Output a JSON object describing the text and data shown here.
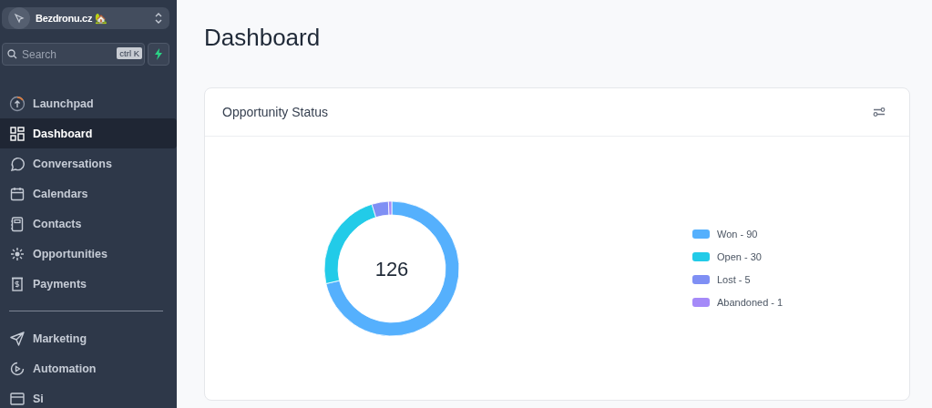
{
  "sidebar": {
    "account": {
      "name": "Bezdronu.cz",
      "emoji": "🏡"
    },
    "search": {
      "placeholder": "Search",
      "shortcut": "ctrl K"
    },
    "items": [
      {
        "label": "Launchpad",
        "selected": false
      },
      {
        "label": "Dashboard",
        "selected": true
      },
      {
        "label": "Conversations",
        "selected": false
      },
      {
        "label": "Calendars",
        "selected": false
      },
      {
        "label": "Contacts",
        "selected": false
      },
      {
        "label": "Opportunities",
        "selected": false
      },
      {
        "label": "Payments",
        "selected": false
      },
      {
        "label": "Marketing",
        "selected": false,
        "divider_before": true
      },
      {
        "label": "Automation",
        "selected": false
      },
      {
        "label": "Si",
        "selected": false
      }
    ]
  },
  "page": {
    "title": "Dashboard"
  },
  "card": {
    "title": "Opportunity Status",
    "total": "126",
    "legend": [
      {
        "color": "#55b0fd"
      },
      {
        "color": "#22cbe8"
      },
      {
        "color": "#7f8ff4"
      },
      {
        "color": "#a58af8"
      }
    ],
    "chart_data": {
      "type": "donut",
      "categories": [
        "Won - 90",
        "Open - 30",
        "Lost - 5",
        "Abandoned - 1"
      ],
      "values": [
        71.43,
        23.81,
        3.97,
        0.79
      ]
    }
  }
}
